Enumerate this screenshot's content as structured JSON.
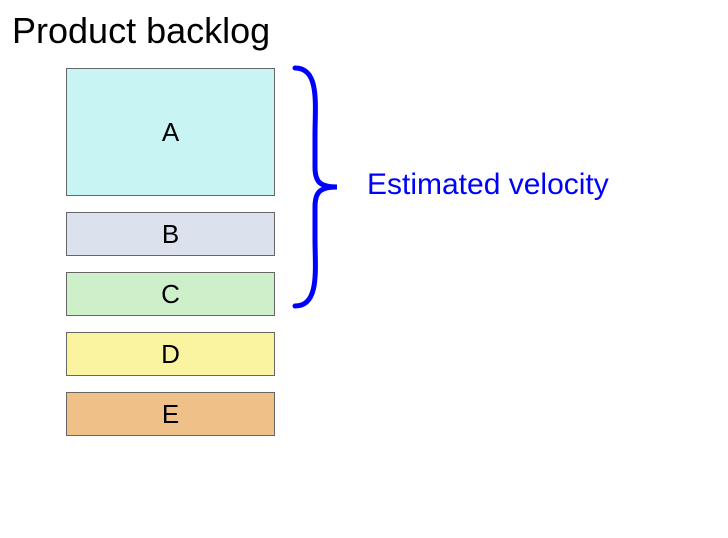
{
  "title": "Product backlog",
  "items": [
    {
      "label": "A",
      "color": "#c8f4f4",
      "heightClass": "item-a"
    },
    {
      "label": "B",
      "color": "#dbe2ee",
      "heightClass": "item-bcde"
    },
    {
      "label": "C",
      "color": "#cdf0ca",
      "heightClass": "item-bcde"
    },
    {
      "label": "D",
      "color": "#faf3a0",
      "heightClass": "item-bcde"
    },
    {
      "label": "E",
      "color": "#f0c089",
      "heightClass": "item-bcde"
    }
  ],
  "bracket": {
    "covers": [
      "A",
      "B",
      "C"
    ],
    "label": "Estimated velocity",
    "color": "#0000ff"
  }
}
